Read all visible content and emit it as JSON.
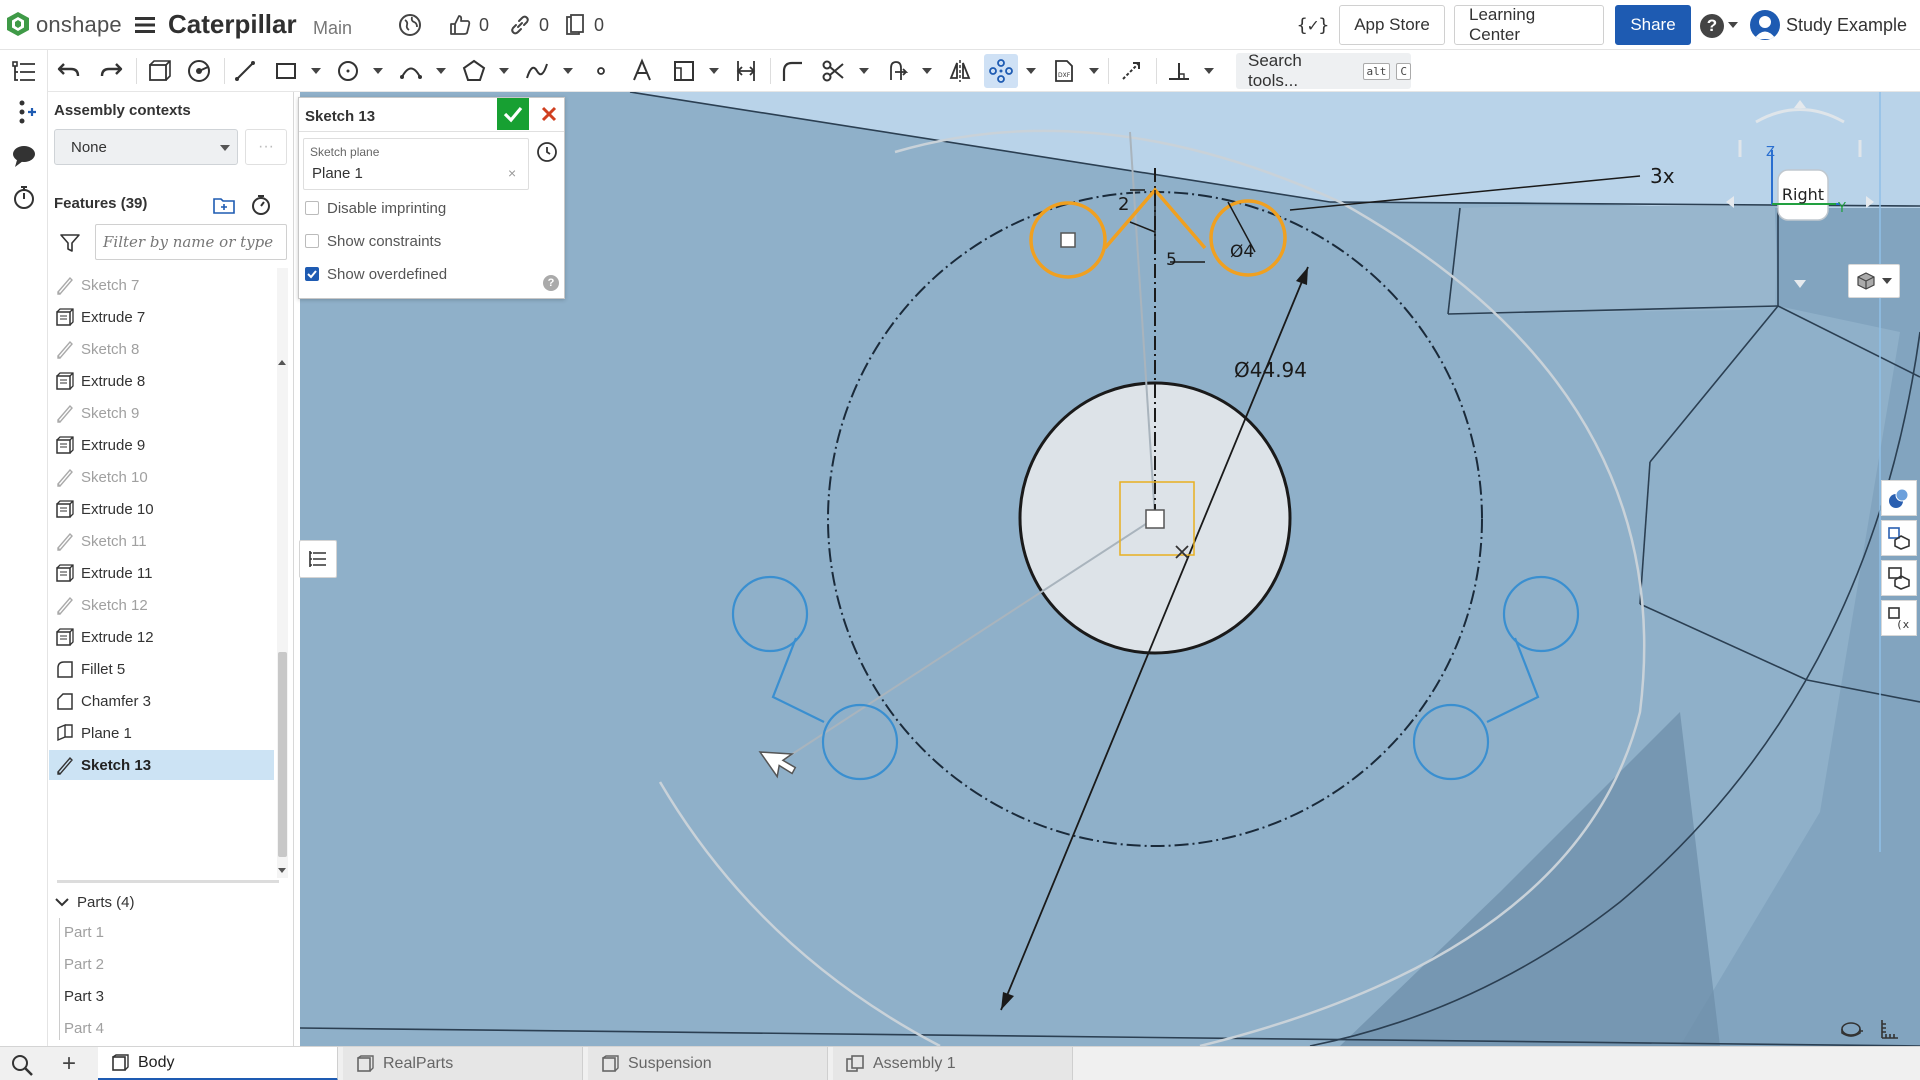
{
  "header": {
    "brand": "onshape",
    "document_title": "Caterpillar",
    "branch": "Main",
    "likes": "0",
    "links": "0",
    "copies": "0",
    "app_store_label": "App Store",
    "learning_center_label": "Learning Center",
    "share_label": "Share",
    "json_icon_text": "{✓}",
    "help_icon_text": "?",
    "user_name": "Study Example"
  },
  "toolbar": {
    "search_label": "Search tools...",
    "search_shortcut_1": "alt",
    "search_shortcut_2": "C"
  },
  "panel": {
    "assembly_contexts_label": "Assembly contexts",
    "assembly_context_value": "None",
    "more_label": "···",
    "features_label": "Features (39)",
    "filter_placeholder": "Filter by name or type",
    "features": [
      {
        "label": "Sketch 7",
        "kind": "sketch"
      },
      {
        "label": "Extrude 7",
        "kind": "extrude"
      },
      {
        "label": "Sketch 8",
        "kind": "sketch"
      },
      {
        "label": "Extrude 8",
        "kind": "extrude"
      },
      {
        "label": "Sketch 9",
        "kind": "sketch"
      },
      {
        "label": "Extrude 9",
        "kind": "extrude"
      },
      {
        "label": "Sketch 10",
        "kind": "sketch"
      },
      {
        "label": "Extrude 10",
        "kind": "extrude"
      },
      {
        "label": "Sketch 11",
        "kind": "sketch"
      },
      {
        "label": "Extrude 11",
        "kind": "extrude"
      },
      {
        "label": "Sketch 12",
        "kind": "sketch"
      },
      {
        "label": "Extrude 12",
        "kind": "extrude"
      },
      {
        "label": "Fillet 5",
        "kind": "fillet"
      },
      {
        "label": "Chamfer 3",
        "kind": "chamfer"
      },
      {
        "label": "Plane 1",
        "kind": "plane"
      },
      {
        "label": "Sketch 13",
        "kind": "sketch-selected"
      }
    ],
    "parts_label": "Parts (4)",
    "parts": [
      "Part 1",
      "Part 2",
      "Part 3",
      "Part 4"
    ]
  },
  "sketch_dialog": {
    "title": "Sketch 13",
    "sketch_plane_label": "Sketch plane",
    "sketch_plane_value": "Plane 1",
    "clear_label": "×",
    "disable_imprinting_label": "Disable imprinting",
    "disable_imprinting_checked": false,
    "show_constraints_label": "Show constraints",
    "show_constraints_checked": false,
    "show_overdefined_label": "Show overdefined",
    "show_overdefined_checked": true,
    "help_label": "?"
  },
  "viewport": {
    "dimension_diameter": "Ø44.94",
    "pattern_count": "3x",
    "dim_small_1": "2",
    "dim_small_2": "5",
    "dim_small_3": "Ø4",
    "view_cube_label": "Right",
    "axis_z": "Z",
    "axis_y": "Y",
    "colors": {
      "background": "#b9d3e9",
      "body": "#8fb0c9",
      "sketch_selected": "#f0a020",
      "sketch_pattern": "#3a8fd0",
      "dimension": "#222222"
    }
  },
  "tabs": [
    {
      "label": "Body",
      "active": true,
      "kind": "partstudio"
    },
    {
      "label": "RealParts",
      "active": false,
      "kind": "partstudio"
    },
    {
      "label": "Suspension",
      "active": false,
      "kind": "partstudio"
    },
    {
      "label": "Assembly 1",
      "active": false,
      "kind": "assembly"
    }
  ]
}
